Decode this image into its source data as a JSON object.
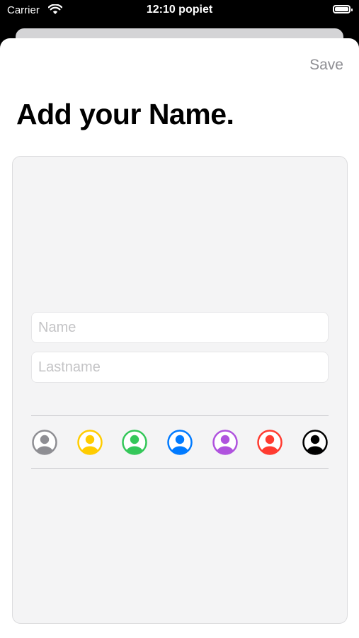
{
  "status_bar": {
    "carrier": "Carrier",
    "time": "12:10 popiet"
  },
  "header": {
    "save_label": "Save",
    "title": "Add your Name."
  },
  "form": {
    "name_placeholder": "Name",
    "name_value": "",
    "lastname_placeholder": "Lastname",
    "lastname_value": ""
  },
  "avatar_colors": [
    {
      "name": "gray",
      "color": "#8e8e93"
    },
    {
      "name": "yellow",
      "color": "#ffcc00"
    },
    {
      "name": "green",
      "color": "#34c759"
    },
    {
      "name": "blue",
      "color": "#007aff"
    },
    {
      "name": "purple",
      "color": "#af52de"
    },
    {
      "name": "red",
      "color": "#ff3b30"
    },
    {
      "name": "black",
      "color": "#000000"
    }
  ]
}
